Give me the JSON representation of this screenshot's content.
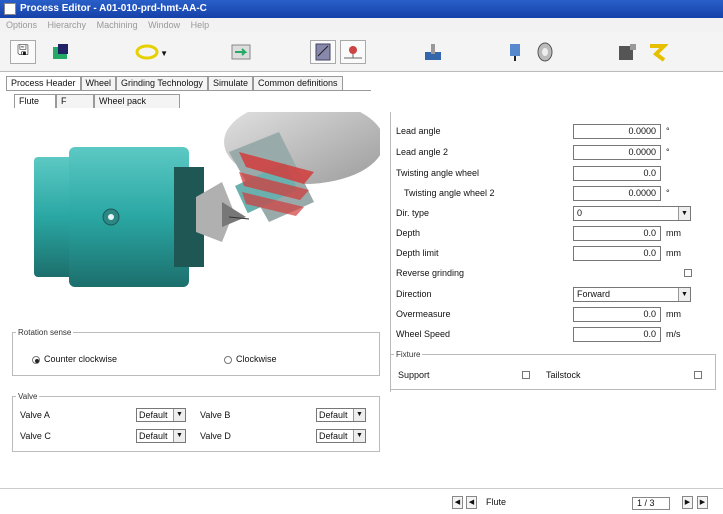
{
  "window": {
    "title": "Process Editor - A01-010-prd-hmt-AA-C"
  },
  "menu": [
    "Options",
    "Hierarchy",
    "Machining",
    "Window",
    "Help"
  ],
  "toolbar": {
    "buttons": [
      {
        "name": "save",
        "icon": "save-icon"
      },
      {
        "name": "process",
        "icon": "process-icon"
      },
      {
        "name": "tool-path",
        "icon": "toolpath-icon"
      },
      {
        "name": "import",
        "icon": "import-icon"
      },
      {
        "name": "machine-view",
        "icon": "machine-icon"
      },
      {
        "name": "simulate",
        "icon": "simulate-icon"
      },
      {
        "name": "machine-tool",
        "icon": "machine-tool-icon"
      },
      {
        "name": "spindle",
        "icon": "spindle-icon"
      },
      {
        "name": "wheel",
        "icon": "wheel-icon"
      },
      {
        "name": "robot",
        "icon": "robot-icon"
      },
      {
        "name": "loader",
        "icon": "loader-icon"
      }
    ]
  },
  "tabs": [
    "Process Header",
    "Wheel",
    "Grinding Technology",
    "Simulate",
    "Common definitions"
  ],
  "subtabs": [
    "Flute",
    "F",
    "Wheel pack"
  ],
  "rotation": {
    "title": "Rotation sense",
    "options": [
      "Counter clockwise",
      "Clockwise"
    ],
    "selected": 0
  },
  "valve": {
    "title": "Valve",
    "rows": [
      {
        "label": "Valve A",
        "value": "Default"
      },
      {
        "label": "Valve B",
        "value": "Default"
      },
      {
        "label": "Valve C",
        "value": "Default"
      },
      {
        "label": "Valve D",
        "value": "Default"
      }
    ]
  },
  "params": [
    {
      "label": "Lead angle",
      "value": "0.0000",
      "unit": "°"
    },
    {
      "label": "Lead angle 2",
      "value": "0.0000",
      "unit": "°"
    },
    {
      "label": "Twisting angle wheel",
      "value": "0.0",
      "unit": ""
    },
    {
      "label": "Twisting angle wheel 2",
      "value": "0.0000",
      "unit": "°"
    },
    {
      "label": "Dir. type",
      "select": "0"
    },
    {
      "label": "Depth",
      "value": "0.0",
      "unit": "mm"
    },
    {
      "label": "Depth limit",
      "value": "0.0",
      "unit": "mm"
    },
    {
      "label": "Reverse grinding",
      "checkbox": true
    },
    {
      "label": "Direction",
      "select": "Forward"
    },
    {
      "label": "Overmeasure",
      "value": "0.0",
      "unit": "mm"
    },
    {
      "label": "Wheel Speed",
      "value": "0.0",
      "unit": "m/s"
    }
  ],
  "fixture": {
    "title": "Fixture",
    "support_label": "Support",
    "tailstock_label": "Tailstock"
  },
  "nav": {
    "label": "Flute",
    "counter": "1 / 3"
  },
  "colors": {
    "title_bg": "#1e4fb8",
    "machine": "#2aa7a3"
  }
}
